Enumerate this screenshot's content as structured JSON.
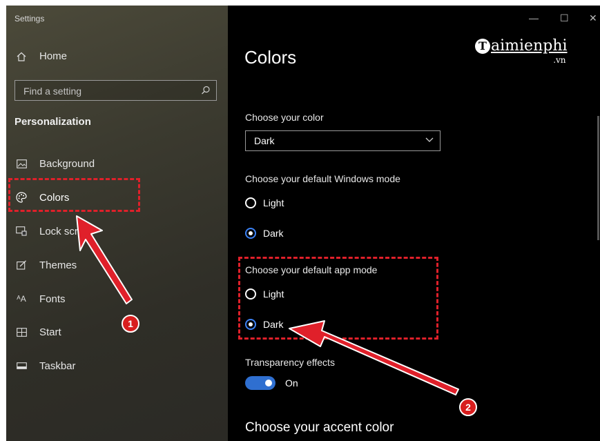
{
  "window": {
    "title": "Settings",
    "minimize_glyph": "—",
    "maximize_glyph": "☐",
    "close_glyph": "✕"
  },
  "sidebar": {
    "home_label": "Home",
    "search_placeholder": "Find a setting",
    "section_title": "Personalization",
    "items": [
      {
        "label": "Background",
        "icon": "image-icon"
      },
      {
        "label": "Colors",
        "icon": "palette-icon",
        "active": true
      },
      {
        "label": "Lock screen",
        "icon": "lock-screen-icon"
      },
      {
        "label": "Themes",
        "icon": "themes-icon"
      },
      {
        "label": "Fonts",
        "icon": "fonts-icon"
      },
      {
        "label": "Start",
        "icon": "start-icon"
      },
      {
        "label": "Taskbar",
        "icon": "taskbar-icon"
      }
    ]
  },
  "main": {
    "title": "Colors",
    "choose_color_label": "Choose your color",
    "choose_color_value": "Dark",
    "windows_mode_label": "Choose your default Windows mode",
    "windows_mode_options": [
      "Light",
      "Dark"
    ],
    "windows_mode_selected": "Dark",
    "app_mode_label": "Choose your default app mode",
    "app_mode_options": [
      "Light",
      "Dark"
    ],
    "app_mode_selected": "Dark",
    "transparency_label": "Transparency effects",
    "transparency_state": "On",
    "accent_title": "Choose your accent color"
  },
  "watermark": {
    "brand": "aimienphi",
    "initial": "T",
    "tld": ".vn"
  },
  "annotations": {
    "badge_1": "1",
    "badge_2": "2",
    "highlight_color": "#e0202a",
    "arrow_color": "#e0202a"
  },
  "colors": {
    "toggle_on": "#2f6fd0",
    "radio_selected": "#3b82f6"
  }
}
